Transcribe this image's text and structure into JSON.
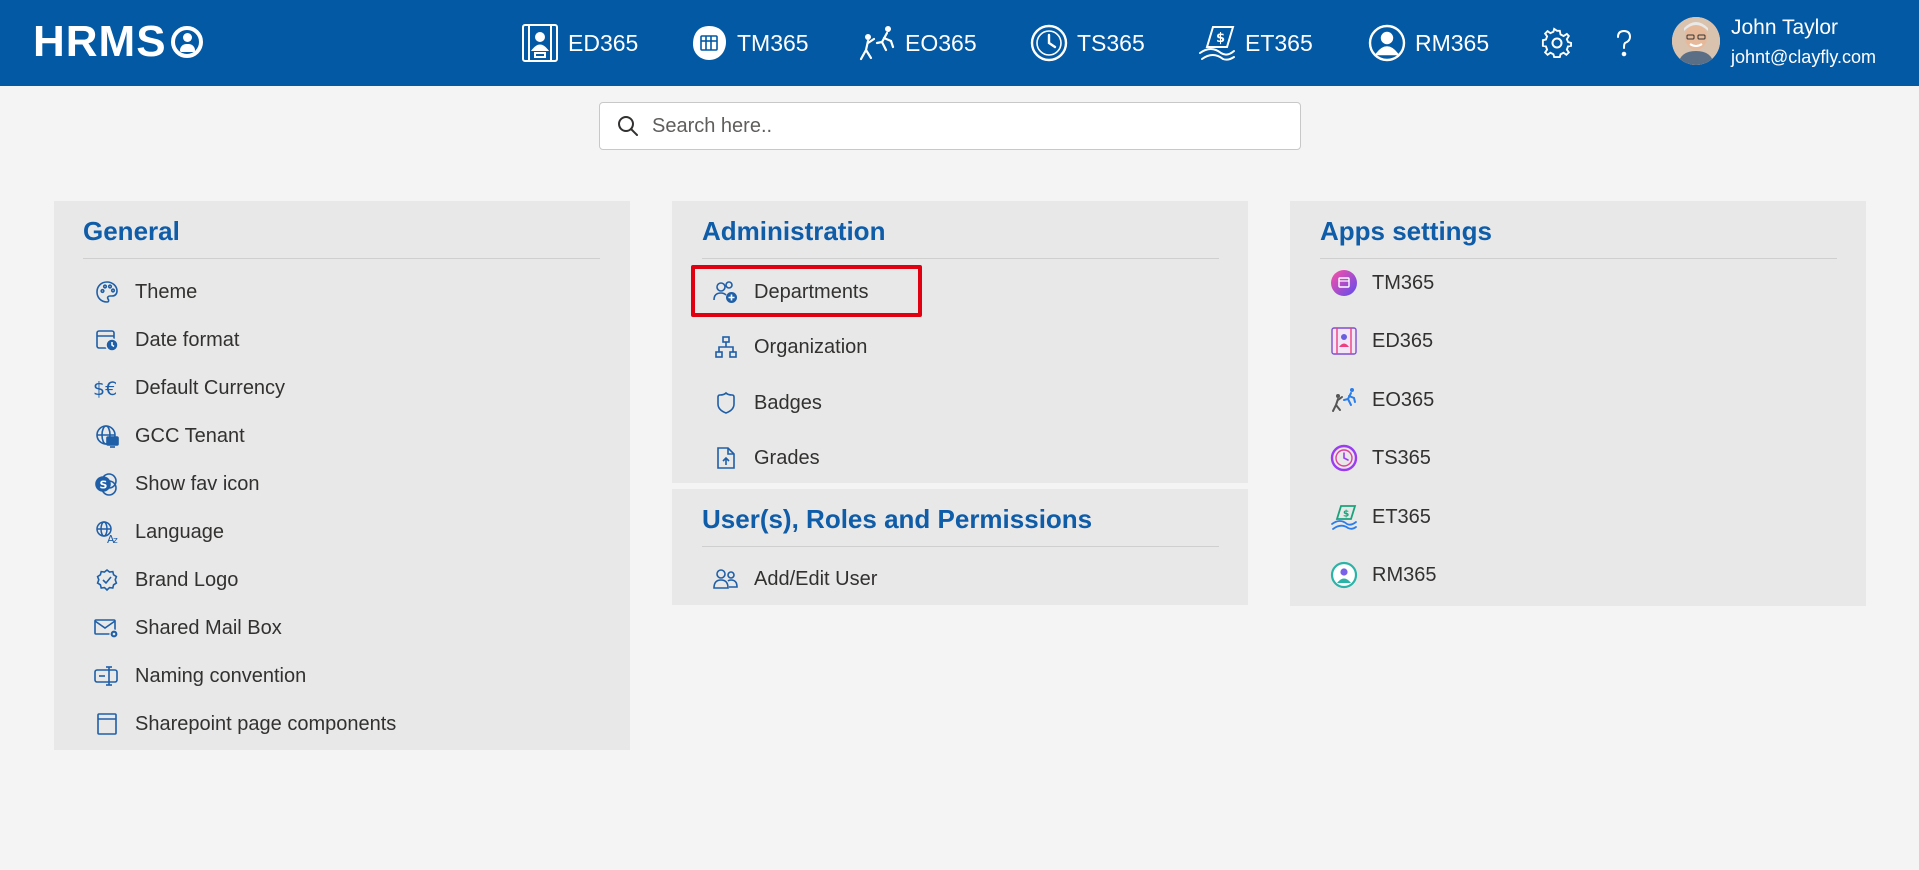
{
  "brand": {
    "text": "HRMS"
  },
  "nav": {
    "apps": [
      {
        "label": "ED365",
        "icon": "employee-directory-icon"
      },
      {
        "label": "TM365",
        "icon": "task-management-icon"
      },
      {
        "label": "EO365",
        "icon": "onboarding-icon"
      },
      {
        "label": "TS365",
        "icon": "timesheet-icon"
      },
      {
        "label": "ET365",
        "icon": "expense-tracker-icon"
      },
      {
        "label": "RM365",
        "icon": "resource-management-icon"
      }
    ],
    "settings_icon": "gear-icon",
    "help_icon": "question-icon"
  },
  "user": {
    "name": "John Taylor",
    "email": "johnt@clayfly.com"
  },
  "search": {
    "placeholder": "Search here.."
  },
  "general": {
    "title": "General",
    "items": [
      {
        "label": "Theme",
        "icon": "palette-icon"
      },
      {
        "label": "Date format",
        "icon": "calendar-clock-icon"
      },
      {
        "label": "Default Currency",
        "icon": "currency-icon"
      },
      {
        "label": "GCC Tenant",
        "icon": "globe-desktop-icon"
      },
      {
        "label": "Show fav icon",
        "icon": "fav-icon"
      },
      {
        "label": "Language",
        "icon": "translate-icon"
      },
      {
        "label": "Brand Logo",
        "icon": "badge-check-icon"
      },
      {
        "label": "Shared Mail Box",
        "icon": "mail-settings-icon"
      },
      {
        "label": "Naming convention",
        "icon": "rename-icon"
      },
      {
        "label": "Sharepoint page components",
        "icon": "page-icon"
      }
    ]
  },
  "administration": {
    "title": "Administration",
    "items": [
      {
        "label": "Departments",
        "icon": "people-add-icon"
      },
      {
        "label": "Organization",
        "icon": "org-chart-icon"
      },
      {
        "label": "Badges",
        "icon": "shield-icon"
      },
      {
        "label": "Grades",
        "icon": "document-arrow-icon"
      }
    ]
  },
  "users": {
    "title": "User(s), Roles and Permissions",
    "items": [
      {
        "label": "Add/Edit User",
        "icon": "people-icon"
      }
    ]
  },
  "apps_settings": {
    "title": "Apps settings",
    "items": [
      {
        "label": "TM365",
        "icon": "tm365-logo-icon"
      },
      {
        "label": "ED365",
        "icon": "ed365-logo-icon"
      },
      {
        "label": "EO365",
        "icon": "eo365-logo-icon"
      },
      {
        "label": "TS365",
        "icon": "ts365-logo-icon"
      },
      {
        "label": "ET365",
        "icon": "et365-logo-icon"
      },
      {
        "label": "RM365",
        "icon": "rm365-logo-icon"
      }
    ]
  },
  "colors": {
    "header": "#0359a4",
    "accent": "#0f5ca8",
    "highlight": "#e1000f"
  }
}
